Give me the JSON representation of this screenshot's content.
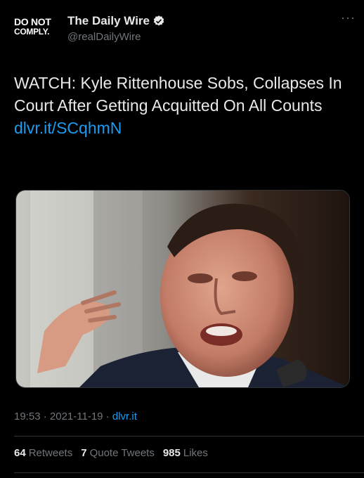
{
  "account": {
    "logo_line1": "DO NOT",
    "logo_line2": "COMPLY.",
    "name": "The Daily Wire",
    "handle": "@realDailyWire",
    "verified_icon": "verified-badge-icon"
  },
  "more_label": "···",
  "tweet": {
    "text": "WATCH: Kyle Rittenhouse Sobs, Collapses In Court After Getting Acquitted On All Counts ",
    "link": "dlvr.it/SCqhmN"
  },
  "meta": {
    "time": "19:53",
    "sep1": " · ",
    "date": "2021-11-19",
    "sep2": " · ",
    "source": "dlvr.it"
  },
  "stats": {
    "retweets_count": "64",
    "retweets_label": "Retweets",
    "quotes_count": "7",
    "quotes_label": "Quote Tweets",
    "likes_count": "985",
    "likes_label": "Likes"
  },
  "colors": {
    "background": "#000000",
    "text": "#e7e9ea",
    "muted": "#71767b",
    "link": "#1d9bf0"
  }
}
